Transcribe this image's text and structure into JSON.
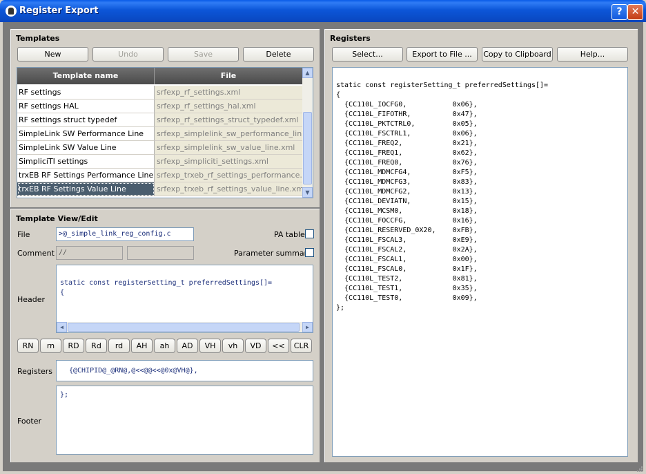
{
  "window": {
    "title": "Register Export"
  },
  "templates": {
    "title": "Templates",
    "buttons": {
      "new": "New",
      "undo": "Undo",
      "save": "Save",
      "delete": "Delete"
    },
    "columns": {
      "name": "Template name",
      "file": "File"
    },
    "rows": [
      {
        "name": "RF settings",
        "file": "srfexp_rf_settings.xml"
      },
      {
        "name": "RF settings HAL",
        "file": "srfexp_rf_settings_hal.xml"
      },
      {
        "name": "RF settings struct typedef",
        "file": "srfexp_rf_settings_struct_typedef.xml"
      },
      {
        "name": "SimpleLink SW Performance Line",
        "file": "srfexp_simplelink_sw_performance_lin..."
      },
      {
        "name": "SimpleLink SW Value Line",
        "file": "srfexp_simplelink_sw_value_line.xml"
      },
      {
        "name": "SimpliciTI settings",
        "file": "srfexp_simpliciti_settings.xml"
      },
      {
        "name": "trxEB RF Settings Performance Line",
        "file": "srfexp_trxeb_rf_settings_performance..."
      },
      {
        "name": "trxEB RF Settings Value Line",
        "file": "srfexp_trxeb_rf_settings_value_line.xml"
      }
    ],
    "selected_index": 7
  },
  "view_edit": {
    "title": "Template View/Edit",
    "file_label": "File",
    "file_value": ">@_simple_link_reg_config.c",
    "pa_table_label": "PA table",
    "comment_label": "Comment",
    "comment_value": "//",
    "parameter_summary_label": "Parameter summary",
    "header_label": "Header",
    "header_text": "static const registerSetting_t preferredSettings[]=\n{",
    "tokens": [
      "RN",
      "rn",
      "RD",
      "Rd",
      "rd",
      "AH",
      "ah",
      "AD",
      "VH",
      "vh",
      "VD",
      "<<",
      "CLR"
    ],
    "registers_label": "Registers",
    "registers_value": "{@CHIPID@_@RN@,@<<@@<<@0x@VH@},",
    "footer_label": "Footer",
    "footer_text": "};"
  },
  "registers": {
    "title": "Registers",
    "buttons": {
      "select": "Select...",
      "export": "Export to File ...",
      "copy": "Copy to Clipboard",
      "help": "Help..."
    },
    "output": "static const registerSetting_t preferredSettings[]=\n{\n  {CC110L_IOCFG0,           0x06},\n  {CC110L_FIFOTHR,          0x47},\n  {CC110L_PKTCTRL0,         0x05},\n  {CC110L_FSCTRL1,          0x06},\n  {CC110L_FREQ2,            0x21},\n  {CC110L_FREQ1,            0x62},\n  {CC110L_FREQ0,            0x76},\n  {CC110L_MDMCFG4,          0xF5},\n  {CC110L_MDMCFG3,          0x83},\n  {CC110L_MDMCFG2,          0x13},\n  {CC110L_DEVIATN,          0x15},\n  {CC110L_MCSM0,            0x18},\n  {CC110L_FOCCFG,           0x16},\n  {CC110L_RESERVED_0X20,    0xFB},\n  {CC110L_FSCAL3,           0xE9},\n  {CC110L_FSCAL2,           0x2A},\n  {CC110L_FSCAL1,           0x00},\n  {CC110L_FSCAL0,           0x1F},\n  {CC110L_TEST2,            0x81},\n  {CC110L_TEST1,            0x35},\n  {CC110L_TEST0,            0x09},\n};"
  },
  "colors": {
    "titlebar": "#0a4cc8",
    "selection": "#4a5d6e",
    "code_text": "#1b2e7a"
  }
}
